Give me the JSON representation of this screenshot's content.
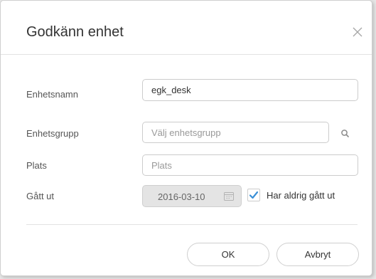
{
  "dialog": {
    "title": "Godkänn enhet",
    "close_icon": "close-icon"
  },
  "form": {
    "device_name": {
      "label": "Enhetsnamn",
      "value": "egk_desk"
    },
    "device_group": {
      "label": "Enhetsgrupp",
      "placeholder": "Välj enhetsgrupp",
      "icon": "search-icon"
    },
    "location": {
      "label": "Plats",
      "placeholder": "Plats"
    },
    "expired": {
      "label": "Gått ut",
      "date": "2016-03-10",
      "icon": "calendar-icon",
      "never_expires_label": "Har aldrig gått ut",
      "never_expires_checked": true
    }
  },
  "buttons": {
    "ok_label": "OK",
    "cancel_label": "Avbryt"
  },
  "colors": {
    "accent": "#3a8fd6",
    "disabled_bg": "#e4e4e4"
  }
}
